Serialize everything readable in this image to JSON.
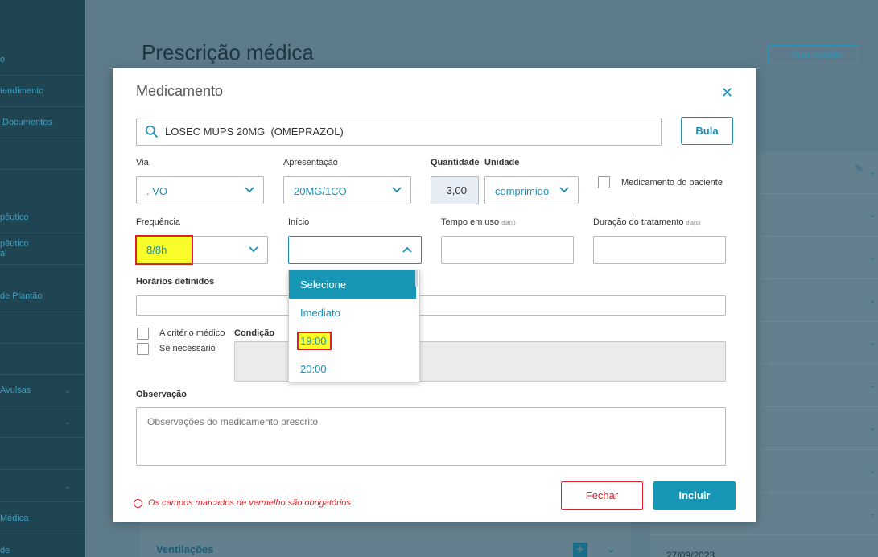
{
  "background": {
    "sidebar_items": [
      {
        "label": "o",
        "has_chevron": false
      },
      {
        "label": "tendimento",
        "has_chevron": false
      },
      {
        "label": " Documentos",
        "has_chevron": false
      },
      {
        "label": "",
        "has_chevron": false
      },
      {
        "label": "pêutico",
        "has_chevron": false
      },
      {
        "label": "pêutico\nal",
        "has_chevron": false
      },
      {
        "label": "de Plantão",
        "has_chevron": false
      },
      {
        "label": "",
        "has_chevron": false
      },
      {
        "label": "",
        "has_chevron": false
      },
      {
        "label": "Avulsas",
        "has_chevron": true
      },
      {
        "label": "",
        "has_chevron": true
      },
      {
        "label": "",
        "has_chevron": false
      },
      {
        "label": "",
        "has_chevron": true
      },
      {
        "label": "Médica",
        "has_chevron": false
      },
      {
        "label": "de",
        "has_chevron": false
      }
    ],
    "page_title": "Prescrição médica",
    "use_model_button": "+ Usar modelo",
    "ventilacoes_label": "Ventilações",
    "date_text": "27/09/2023"
  },
  "modal": {
    "title": "Medicamento",
    "close_icon": "close-icon",
    "search": {
      "value": "LOSEC MUPS 20MG  (OMEPRAZOL)",
      "icon": "search-icon"
    },
    "bula_button": "Bula",
    "via": {
      "label": "Via",
      "value": ". VO"
    },
    "apresentacao": {
      "label": "Apresentação",
      "value": "20MG/1CO"
    },
    "quantidade": {
      "label": "Quantidade",
      "value": "3,00"
    },
    "unidade": {
      "label": "Unidade",
      "value": "comprimido"
    },
    "medicamento_paciente": "Medicamento do paciente",
    "frequencia": {
      "label": "Frequência",
      "value": "8/8h"
    },
    "inicio": {
      "label": "Início",
      "value": "",
      "options": [
        "Selecione",
        "Imediato",
        "19:00",
        "20:00"
      ],
      "selected_index": 0
    },
    "tempo_em_uso": {
      "label": "Tempo em uso",
      "unit": "dia(s)"
    },
    "duracao_tratamento": {
      "label": "Duração do tratamento",
      "unit": "dia(s)"
    },
    "horarios_definidos": {
      "label": "Horários definidos"
    },
    "criterio_medico": "A critério médico",
    "se_necessario": "Se necessário",
    "condicao": {
      "label": "Condição"
    },
    "observacao": {
      "label": "Observação",
      "placeholder": "Observações do medicamento prescrito"
    },
    "required_note": "Os campos marcados de vermelho são obrigatórios",
    "fechar_button": "Fechar",
    "incluir_button": "Incluir"
  },
  "colors": {
    "accent": "#1896b6",
    "error": "#d9222a",
    "highlight": "#fafc2a"
  }
}
